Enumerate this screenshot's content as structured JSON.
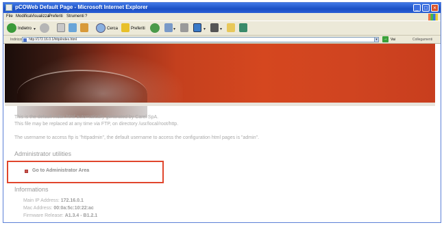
{
  "window": {
    "title": "pCOWeb Default Page - Microsoft Internet Explorer"
  },
  "menu": [
    "File",
    "Modifica",
    "Visualizza",
    "Preferiti",
    "Strumenti",
    "?"
  ],
  "toolbar": {
    "back_label": "Indietro",
    "search_label": "Cerca",
    "favorites_label": "Preferiti"
  },
  "address": {
    "label": "Indirizzo",
    "url": "http://172.16.0.1/http/index.html",
    "go_label": "Vai",
    "links_label": "Collegamenti"
  },
  "page": {
    "intro_line1": "This is the default index.html automatically generated by Carel SpA.",
    "intro_line2": "This file may be replaced at any time via FTP, on directory /usr/local/root/http.",
    "credentials": "The username to access ftp is \"httpadmin\", the default username to access the configuration html pages is \"admin\".",
    "admin_heading": "Administrator utilities",
    "admin_link": "Go to Administrator Area",
    "info_heading": "Informations",
    "info": [
      {
        "label": "Main IP Address:",
        "value": "172.16.0.1"
      },
      {
        "label": "Mac Address:",
        "value": "00:0a:5c:10:22:ac"
      },
      {
        "label": "Firmware Release:",
        "value": "A1.3.4 - B1.2.1"
      }
    ]
  },
  "colors": {
    "highlight": "#e0452c",
    "banner": "#d5471f",
    "titlebar": "#1b4fc4"
  }
}
